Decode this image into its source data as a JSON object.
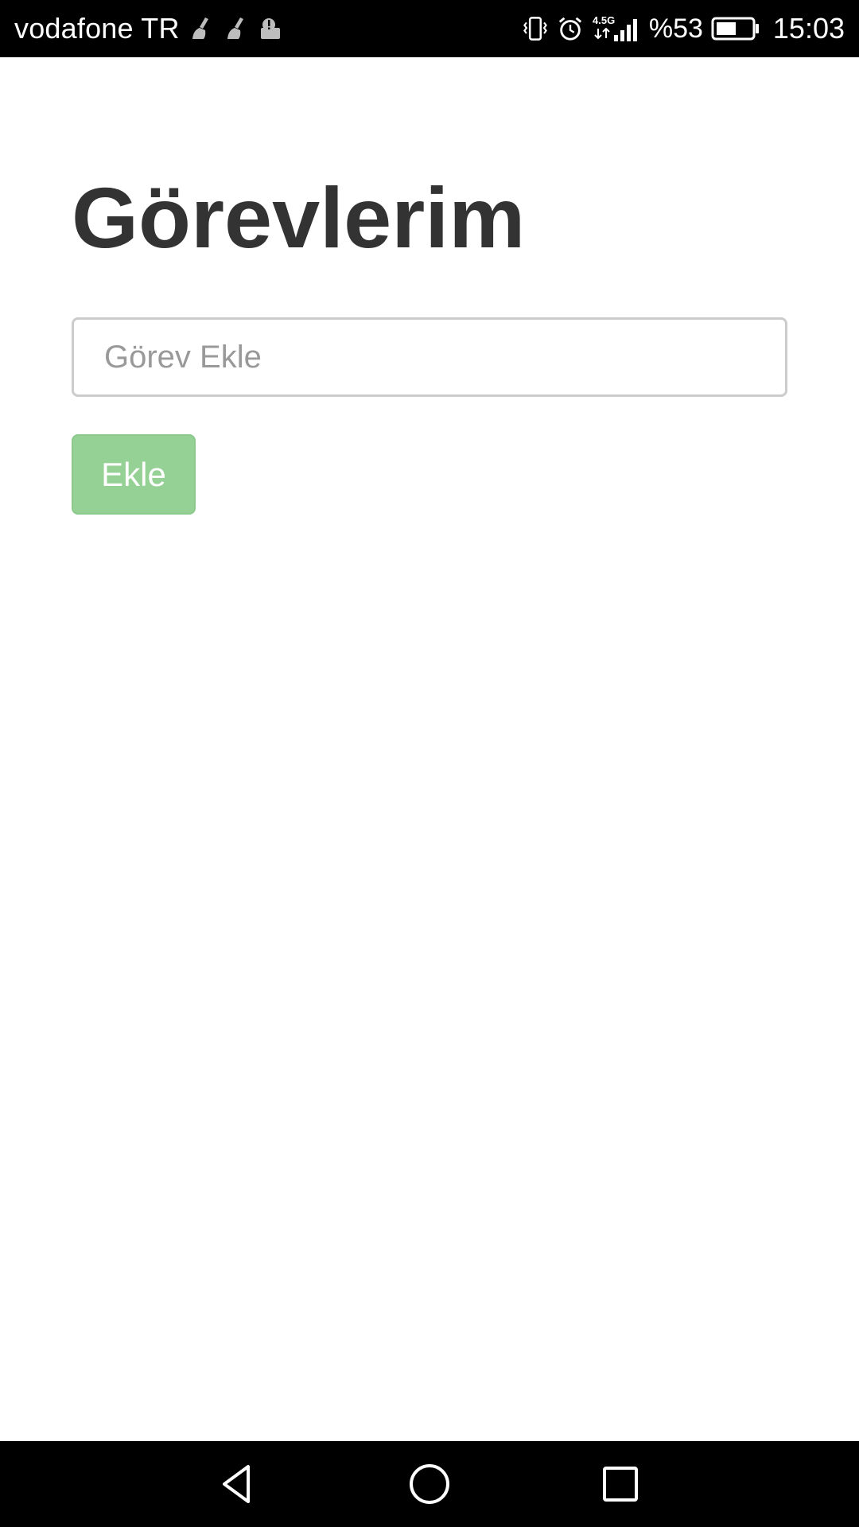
{
  "status_bar": {
    "carrier": "vodafone TR",
    "network_label": "4.5G",
    "battery_percent": "%53",
    "time": "15:03",
    "left_icons": [
      "cleaner-icon",
      "cleaner-icon",
      "alert-app-icon"
    ],
    "right_icons": [
      "vibrate-icon",
      "alarm-icon",
      "signal-icon",
      "battery-icon"
    ]
  },
  "main": {
    "title": "Görevlerim",
    "task_input": {
      "value": "",
      "placeholder": "Görev Ekle"
    },
    "add_button_label": "Ekle"
  },
  "nav_bar": {
    "buttons": [
      "back-icon",
      "home-icon",
      "recents-icon"
    ]
  },
  "colors": {
    "title": "#333333",
    "button_bg": "#95d095",
    "input_border": "#cccccc",
    "placeholder": "#999999"
  }
}
